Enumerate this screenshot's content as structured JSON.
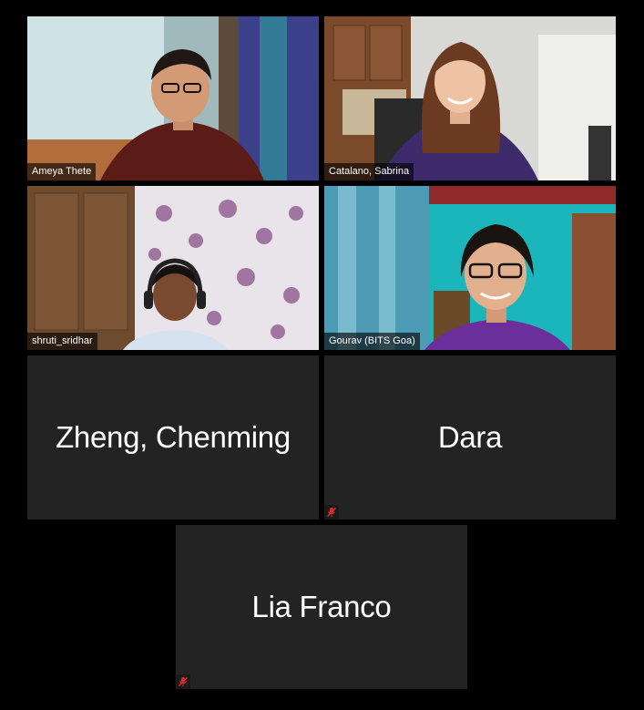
{
  "participants": [
    {
      "name": "Ameya Thete",
      "video": true,
      "active": false,
      "muted_icon": false
    },
    {
      "name": "Catalano, Sabrina",
      "video": true,
      "active": true,
      "muted_icon": false
    },
    {
      "name": "shruti_sridhar",
      "video": true,
      "active": false,
      "muted_icon": false
    },
    {
      "name": "Gourav (BITS Goa)",
      "video": true,
      "active": false,
      "muted_icon": false
    },
    {
      "name": "Zheng, Chenming",
      "video": false,
      "active": false,
      "muted_icon": false
    },
    {
      "name": "Dara",
      "video": false,
      "active": false,
      "muted_icon": true
    },
    {
      "name": "Lia Franco",
      "video": false,
      "active": false,
      "muted_icon": true
    }
  ],
  "icons": {
    "mute": "microphone-muted-icon"
  },
  "colors": {
    "active_speaker_border": "#d9f06a",
    "tile_bg": "#232323",
    "mute_icon": "#e02828"
  }
}
